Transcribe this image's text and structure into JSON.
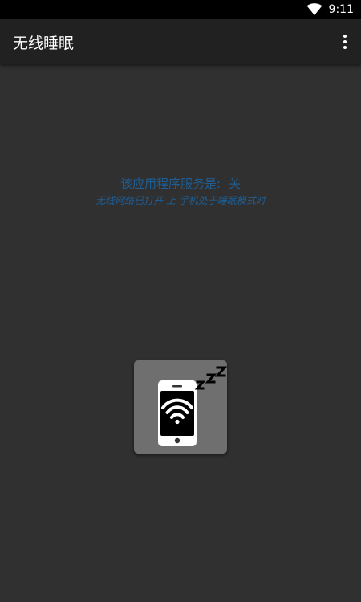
{
  "status_bar": {
    "time": "9:11",
    "icons": [
      "wifi-icon"
    ]
  },
  "app_bar": {
    "title": "无线睡眠",
    "menu_icon": "overflow-menu-icon"
  },
  "service": {
    "status_label": "该应用程序服务是:",
    "status_value": "关",
    "description": "无线网络已打开 上 手机处于睡眠模式时"
  },
  "toggle": {
    "icon": "phone-wifi-sleep-icon",
    "sleep_text": "ZZZ"
  },
  "colors": {
    "background": "#303030",
    "app_bar": "#212121",
    "status_bar": "#000000",
    "accent_text": "#1d5f96",
    "tile": "#6f6f6f"
  }
}
